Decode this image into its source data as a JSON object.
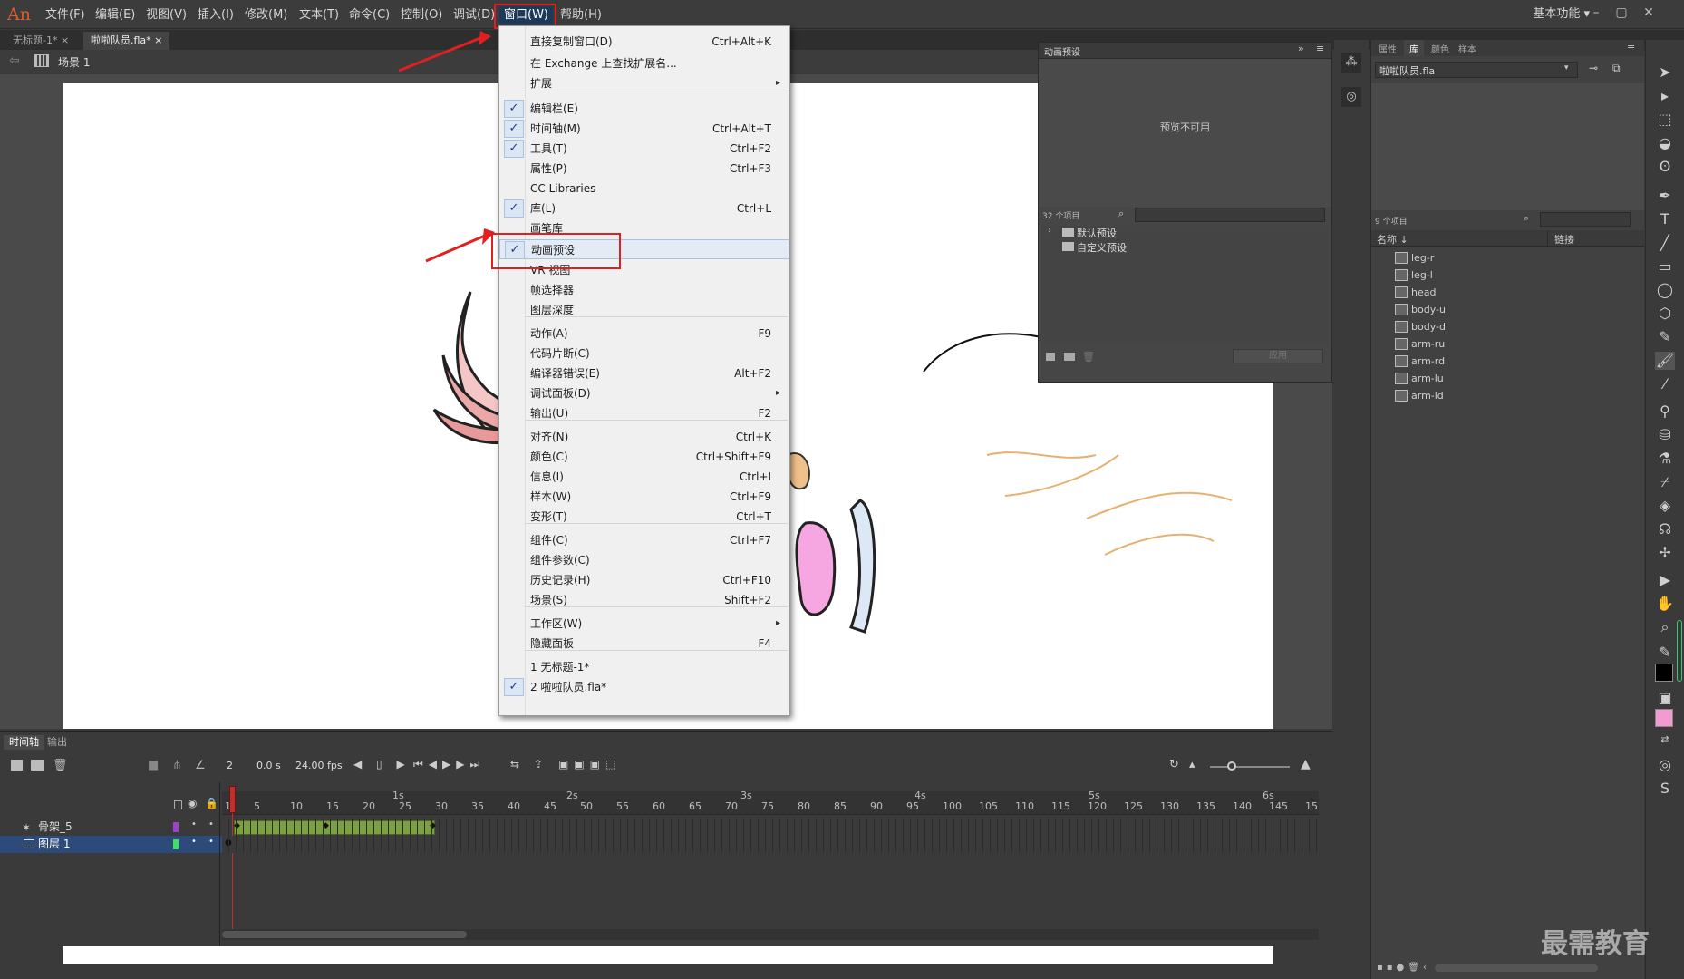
{
  "app": {
    "logo": "An"
  },
  "menubar": {
    "items": [
      "文件(F)",
      "编辑(E)",
      "视图(V)",
      "插入(I)",
      "修改(M)",
      "文本(T)",
      "命令(C)",
      "控制(O)",
      "调试(D)",
      "窗口(W)",
      "帮助(H)"
    ],
    "workspace": "基本功能"
  },
  "tabs": [
    {
      "label": "无标题-1*",
      "close": "×"
    },
    {
      "label": "啦啦队员.fla*",
      "close": "×"
    }
  ],
  "scene": {
    "label": "场景 1"
  },
  "window_menu": {
    "items": [
      {
        "label": "直接复制窗口(D)",
        "shortcut": "Ctrl+Alt+K"
      },
      {
        "label": "在 Exchange 上查找扩展名...",
        "shortcut": ""
      },
      {
        "label": "扩展",
        "shortcut": "",
        "submenu": "▸"
      },
      {
        "label": "编辑栏(E)",
        "shortcut": "",
        "checked": "✓"
      },
      {
        "label": "时间轴(M)",
        "shortcut": "Ctrl+Alt+T",
        "checked": "✓"
      },
      {
        "label": "工具(T)",
        "shortcut": "Ctrl+F2",
        "checked": "✓"
      },
      {
        "label": "属性(P)",
        "shortcut": "Ctrl+F3"
      },
      {
        "label": "CC Libraries",
        "shortcut": ""
      },
      {
        "label": "库(L)",
        "shortcut": "Ctrl+L",
        "checked": "✓"
      },
      {
        "label": "画笔库",
        "shortcut": ""
      },
      {
        "label": "动画预设",
        "shortcut": "",
        "checked": "✓"
      },
      {
        "label": "VR 视图",
        "shortcut": ""
      },
      {
        "label": "帧选择器",
        "shortcut": ""
      },
      {
        "label": "图层深度",
        "shortcut": ""
      },
      {
        "label": "动作(A)",
        "shortcut": "F9"
      },
      {
        "label": "代码片断(C)",
        "shortcut": ""
      },
      {
        "label": "编译器错误(E)",
        "shortcut": "Alt+F2"
      },
      {
        "label": "调试面板(D)",
        "shortcut": "",
        "submenu": "▸"
      },
      {
        "label": "输出(U)",
        "shortcut": "F2"
      },
      {
        "label": "对齐(N)",
        "shortcut": "Ctrl+K"
      },
      {
        "label": "颜色(C)",
        "shortcut": "Ctrl+Shift+F9"
      },
      {
        "label": "信息(I)",
        "shortcut": "Ctrl+I"
      },
      {
        "label": "样本(W)",
        "shortcut": "Ctrl+F9"
      },
      {
        "label": "变形(T)",
        "shortcut": "Ctrl+T"
      },
      {
        "label": "组件(C)",
        "shortcut": "Ctrl+F7"
      },
      {
        "label": "组件参数(C)",
        "shortcut": ""
      },
      {
        "label": "历史记录(H)",
        "shortcut": "Ctrl+F10"
      },
      {
        "label": "场景(S)",
        "shortcut": "Shift+F2"
      },
      {
        "label": "工作区(W)",
        "shortcut": "",
        "submenu": "▸"
      },
      {
        "label": "隐藏面板",
        "shortcut": "F4"
      },
      {
        "label": "1 无标题-1*",
        "shortcut": ""
      },
      {
        "label": "2 啦啦队员.fla*",
        "shortcut": "",
        "checked": "✓"
      }
    ]
  },
  "anim_panel": {
    "title": "动画预设",
    "preview": "预览不可用",
    "count": "32 个项目",
    "folders": [
      "默认预设",
      "自定义预设"
    ],
    "apply": "应用"
  },
  "props_panel": {
    "tabs": [
      "属性",
      "库",
      "颜色",
      "样本"
    ],
    "file": "啦啦队员.fla",
    "count": "9 个项目",
    "col_name": "名称 ↓",
    "col_link": "链接",
    "items": [
      "leg-r",
      "leg-l",
      "head",
      "body-u",
      "body-d",
      "arm-ru",
      "arm-rd",
      "arm-lu",
      "arm-ld"
    ]
  },
  "timeline": {
    "tabs": [
      "时间轴",
      "输出"
    ],
    "frame": "2",
    "time": "0.0 s",
    "fps": "24.00 fps",
    "seconds": [
      "1s",
      "2s",
      "3s",
      "4s",
      "5s",
      "6s"
    ],
    "ticks": [
      "1",
      "5",
      "10",
      "15",
      "20",
      "25",
      "30",
      "35",
      "40",
      "45",
      "50",
      "55",
      "60",
      "65",
      "70",
      "75",
      "80",
      "85",
      "90",
      "95",
      "100",
      "105",
      "110",
      "115",
      "120",
      "125",
      "130",
      "135",
      "140",
      "145",
      "15"
    ],
    "layers": [
      {
        "name": "骨架_5",
        "color": "#a040d0"
      },
      {
        "name": "图层 1",
        "color": "#40e060"
      }
    ]
  },
  "colors": {
    "accent": "#1e3a5a",
    "redbox": "#e02020",
    "span": "#7aa040",
    "fill_swatch": "#f29bd0",
    "stroke_swatch": "#000000"
  },
  "watermark": "最需教育"
}
